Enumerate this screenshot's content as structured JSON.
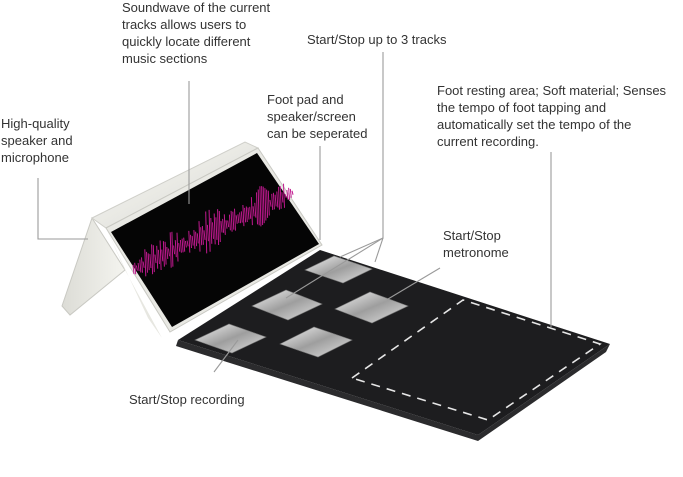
{
  "annotations": {
    "soundwave": "Soundwave of the current\ntracks allows users to\nquickly locate different\nmusic sections",
    "tracks": "Start/Stop up to 3 tracks",
    "foot_resting": "Foot resting area; Soft material; Senses\nthe tempo of foot tapping and\nautomatically set the tempo of the\ncurrent recording.",
    "speaker": "High-quality\nspeaker and\nmicrophone",
    "separable": "Foot pad and\nspeaker/screen\ncan be seperated",
    "metronome": "Start/Stop\nmetronome",
    "recording": "Start/Stop recording"
  },
  "colors": {
    "text": "#333333",
    "leader_line": "#9a9a9a",
    "pad_surface": "#1d1d1f",
    "screen": "#050505",
    "waveform": "#c0198f",
    "dashed_outline": "#e6e6e6"
  }
}
